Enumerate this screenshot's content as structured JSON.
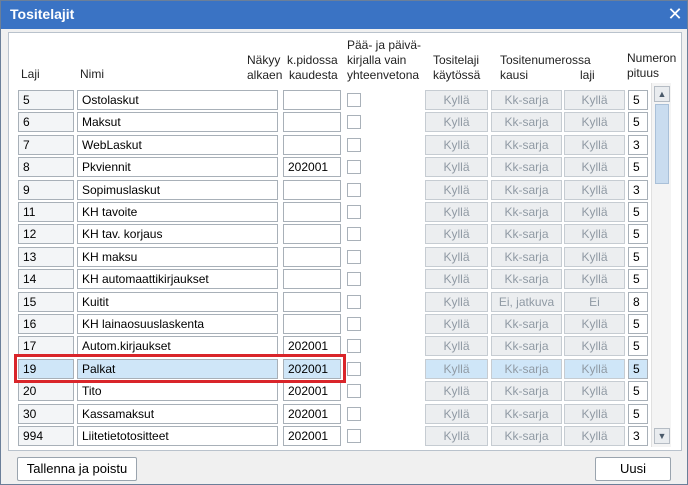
{
  "window": {
    "title": "Tositelajit"
  },
  "headers": {
    "laji": "Laji",
    "nimi": "Nimi",
    "nakyy_1": "Näkyy",
    "nakyy_2": "alkaen",
    "kpidossa_1": "k.pidossa",
    "kpidossa_2": "kaudesta",
    "paa_1": "Pää- ja päivä-",
    "paa_2": "kirjalla vain",
    "paa_3": "yhteenvetona",
    "tositelaji_1": "Tositelaji",
    "tositelaji_2": "käytössä",
    "tositenum_1": "Tositenumerossa",
    "tositenum_kausi": "kausi",
    "tositenum_laji": "laji",
    "pituus_1": "Numeron",
    "pituus_2": "pituus"
  },
  "rows": [
    {
      "laji": "5",
      "nimi": "Ostolaskut",
      "kausi": "",
      "kaytossa": "Kyllä",
      "nro_kausi": "Kk-sarja",
      "nro_laji": "Kyllä",
      "pituus": "5"
    },
    {
      "laji": "6",
      "nimi": "Maksut",
      "kausi": "",
      "kaytossa": "Kyllä",
      "nro_kausi": "Kk-sarja",
      "nro_laji": "Kyllä",
      "pituus": "5"
    },
    {
      "laji": "7",
      "nimi": "WebLaskut",
      "kausi": "",
      "kaytossa": "Kyllä",
      "nro_kausi": "Kk-sarja",
      "nro_laji": "Kyllä",
      "pituus": "3"
    },
    {
      "laji": "8",
      "nimi": "Pkviennit",
      "kausi": "202001",
      "kaytossa": "Kyllä",
      "nro_kausi": "Kk-sarja",
      "nro_laji": "Kyllä",
      "pituus": "5"
    },
    {
      "laji": "9",
      "nimi": "Sopimuslaskut",
      "kausi": "",
      "kaytossa": "Kyllä",
      "nro_kausi": "Kk-sarja",
      "nro_laji": "Kyllä",
      "pituus": "3"
    },
    {
      "laji": "11",
      "nimi": "KH tavoite",
      "kausi": "",
      "kaytossa": "Kyllä",
      "nro_kausi": "Kk-sarja",
      "nro_laji": "Kyllä",
      "pituus": "5"
    },
    {
      "laji": "12",
      "nimi": "KH tav. korjaus",
      "kausi": "",
      "kaytossa": "Kyllä",
      "nro_kausi": "Kk-sarja",
      "nro_laji": "Kyllä",
      "pituus": "5"
    },
    {
      "laji": "13",
      "nimi": "KH maksu",
      "kausi": "",
      "kaytossa": "Kyllä",
      "nro_kausi": "Kk-sarja",
      "nro_laji": "Kyllä",
      "pituus": "5"
    },
    {
      "laji": "14",
      "nimi": "KH automaattikirjaukset",
      "kausi": "",
      "kaytossa": "Kyllä",
      "nro_kausi": "Kk-sarja",
      "nro_laji": "Kyllä",
      "pituus": "5"
    },
    {
      "laji": "15",
      "nimi": "Kuitit",
      "kausi": "",
      "kaytossa": "Kyllä",
      "nro_kausi": "Ei, jatkuva",
      "nro_laji": "Ei",
      "pituus": "8"
    },
    {
      "laji": "16",
      "nimi": "KH lainaosuuslaskenta",
      "kausi": "",
      "kaytossa": "Kyllä",
      "nro_kausi": "Kk-sarja",
      "nro_laji": "Kyllä",
      "pituus": "5"
    },
    {
      "laji": "17",
      "nimi": "Autom.kirjaukset",
      "kausi": "202001",
      "kaytossa": "Kyllä",
      "nro_kausi": "Kk-sarja",
      "nro_laji": "Kyllä",
      "pituus": "5"
    },
    {
      "laji": "19",
      "nimi": "Palkat",
      "kausi": "202001",
      "kaytossa": "Kyllä",
      "nro_kausi": "Kk-sarja",
      "nro_laji": "Kyllä",
      "pituus": "5",
      "selected": true
    },
    {
      "laji": "20",
      "nimi": "Tito",
      "kausi": "202001",
      "kaytossa": "Kyllä",
      "nro_kausi": "Kk-sarja",
      "nro_laji": "Kyllä",
      "pituus": "5"
    },
    {
      "laji": "30",
      "nimi": "Kassamaksut",
      "kausi": "202001",
      "kaytossa": "Kyllä",
      "nro_kausi": "Kk-sarja",
      "nro_laji": "Kyllä",
      "pituus": "5"
    },
    {
      "laji": "994",
      "nimi": "Liitetietotositteet",
      "kausi": "202001",
      "kaytossa": "Kyllä",
      "nro_kausi": "Kk-sarja",
      "nro_laji": "Kyllä",
      "pituus": "3"
    }
  ],
  "footer": {
    "save_label": "Tallenna ja poistu",
    "new_label": "Uusi"
  },
  "colors": {
    "titlebar": "#3a73c4",
    "highlight": "#d9252a",
    "selected_row": "#cfe6f8"
  }
}
